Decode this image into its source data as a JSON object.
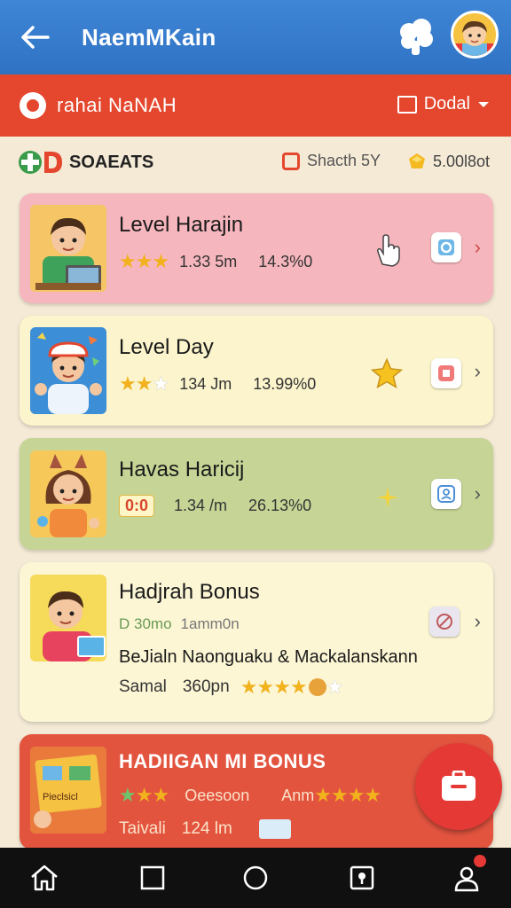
{
  "appbar": {
    "title": "NaemMKain"
  },
  "banner": {
    "title": "rahai NaNAH",
    "dropdown_label": "Dodal"
  },
  "section": {
    "title": "SOAEATS",
    "search_label": "Shacth 5Y",
    "coins": "5.00l8ot"
  },
  "cards": [
    {
      "title": "Level Harajin",
      "value1": "1.33 5m",
      "value2": "14.3%0",
      "rating": 3
    },
    {
      "title": "Level Day",
      "value1": "134 Jm",
      "value2": "13.99%0",
      "rating": 2
    },
    {
      "title": "Havas Haricij",
      "badge": "0:0",
      "value1": "1.34 /m",
      "value2": "26.13%0"
    },
    {
      "title": "Hadjrah Bonus",
      "sub_left": "D 30mo",
      "sub_right": "1amm0n",
      "line2": "BeJialn Naonguaku & Mackalanskann",
      "line3_label": "Samal",
      "line3_value": "360pn",
      "rating": 4
    },
    {
      "title": "HADIIGAN MI BONUS",
      "sub_mid": "Oeesoon",
      "sub_right": "Anm",
      "line3_label": "Taivali",
      "line3_value": "124 lm",
      "thumb_text": "Pieclsicl",
      "rating": 3
    }
  ],
  "colors": {
    "appbar": "#2f72c4",
    "banner": "#e4472e",
    "background": "#f4ead6",
    "card_pink": "#f6b6bd",
    "card_yellow": "#fbf4cc",
    "card_green": "#c6d596",
    "card_red": "#e3543f",
    "fab": "#e53935"
  },
  "icons": [
    "back-arrow-icon",
    "cloud-icon",
    "user-avatar",
    "logo-icon",
    "dropdown-icon",
    "search-icon",
    "coin-icon",
    "hand-icon",
    "star-icon",
    "sparkle-icon",
    "home-icon",
    "square-icon",
    "circle-icon",
    "map-pin-icon",
    "profile-icon"
  ]
}
